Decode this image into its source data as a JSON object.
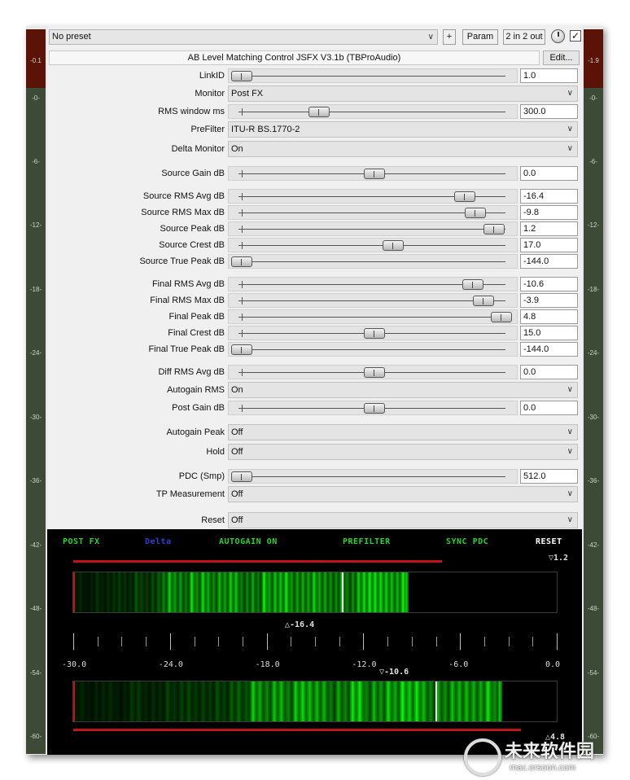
{
  "toolbar": {
    "preset_value": "No preset",
    "plus_label": "+",
    "param_label": "Param",
    "io_label": "2 in 2 out",
    "bypass_check": "☑"
  },
  "title": "AB Level Matching Control JSFX V3.1b (TBProAudio)",
  "edit_label": "Edit...",
  "meters": {
    "left_top": "-0.1",
    "right_top": "-1.9",
    "ticks": [
      "-0-",
      "-6-",
      "-12-",
      "-18-",
      "-24-",
      "-30-",
      "-36-",
      "-42-",
      "-48-",
      "-54-",
      "-60-"
    ]
  },
  "params": [
    {
      "id": "linkid",
      "label": "LinkID",
      "type": "slider",
      "value": "1.0",
      "level": 0.0
    },
    {
      "id": "monitor",
      "label": "Monitor",
      "type": "dropdown",
      "value": "Post FX"
    },
    {
      "id": "rms-window",
      "label": "RMS window ms",
      "type": "slider",
      "value": "300.0",
      "level": 0.29
    },
    {
      "id": "prefilter",
      "label": "PreFilter",
      "type": "dropdown",
      "value": "ITU-R BS.1770-2"
    },
    {
      "id": "delta-monitor",
      "label": "Delta Monitor",
      "type": "dropdown",
      "value": "On"
    },
    {
      "id": "source-gain",
      "label": "Source Gain dB",
      "type": "slider",
      "value": "0.0",
      "level": 0.5
    },
    {
      "id": "source-rms-avg",
      "label": "Source RMS Avg dB",
      "type": "slider",
      "value": "-16.4",
      "level": 0.84
    },
    {
      "id": "source-rms-max",
      "label": "Source RMS Max dB",
      "type": "slider",
      "value": "-9.8",
      "level": 0.88
    },
    {
      "id": "source-peak",
      "label": "Source Peak dB",
      "type": "slider",
      "value": "1.2",
      "level": 0.95
    },
    {
      "id": "source-crest",
      "label": "Source Crest dB",
      "type": "slider",
      "value": "17.0",
      "level": 0.57
    },
    {
      "id": "source-true-peak",
      "label": "Source True Peak dB",
      "type": "slider",
      "value": "-144.0",
      "level": 0.0
    },
    {
      "id": "final-rms-avg",
      "label": "Final RMS Avg dB",
      "type": "slider",
      "value": "-10.6",
      "level": 0.87
    },
    {
      "id": "final-rms-max",
      "label": "Final RMS Max dB",
      "type": "slider",
      "value": "-3.9",
      "level": 0.91
    },
    {
      "id": "final-peak",
      "label": "Final Peak dB",
      "type": "slider",
      "value": "4.8",
      "level": 0.98
    },
    {
      "id": "final-crest",
      "label": "Final Crest dB",
      "type": "slider",
      "value": "15.0",
      "level": 0.5
    },
    {
      "id": "final-true-peak",
      "label": "Final True Peak dB",
      "type": "slider",
      "value": "-144.0",
      "level": 0.0
    },
    {
      "id": "diff-rms-avg",
      "label": "Diff RMS Avg dB",
      "type": "slider",
      "value": "0.0",
      "level": 0.5
    },
    {
      "id": "autogain-rms",
      "label": "Autogain RMS",
      "type": "dropdown",
      "value": "On"
    },
    {
      "id": "post-gain",
      "label": "Post Gain dB",
      "type": "slider",
      "value": "0.0",
      "level": 0.5
    },
    {
      "id": "autogain-peak",
      "label": "Autogain Peak",
      "type": "dropdown",
      "value": "Off"
    },
    {
      "id": "hold",
      "label": "Hold",
      "type": "dropdown",
      "value": "Off"
    },
    {
      "id": "pdc",
      "label": "PDC (Smp)",
      "type": "slider",
      "value": "512.0",
      "level": 0.0
    },
    {
      "id": "tp-measurement",
      "label": "TP Measurement",
      "type": "dropdown",
      "value": "Off"
    },
    {
      "id": "reset",
      "label": "Reset",
      "type": "dropdown",
      "value": "Off"
    }
  ],
  "display": {
    "status": [
      {
        "id": "post-fx",
        "label": "POST FX",
        "color": "#27d52a"
      },
      {
        "id": "delta",
        "label": "Delta",
        "color": "#2f3fd8"
      },
      {
        "id": "autogain-on",
        "label": "AUTOGAIN ON",
        "color": "#27d52a"
      },
      {
        "id": "prefilter",
        "label": "PREFILTER",
        "color": "#27d52a"
      },
      {
        "id": "sync-pdc",
        "label": "SYNC PDC",
        "color": "#27d52a"
      },
      {
        "id": "reset",
        "label": "RESET",
        "color": "#ffffff"
      }
    ],
    "source_peak_marker": "▽1.2",
    "source_rms_marker": "△-16.4",
    "final_rms_marker": "▽-10.6",
    "final_peak_marker": "△4.8",
    "scale_labels": [
      "-30.0",
      "-24.0",
      "-18.0",
      "-12.0",
      "-6.0",
      "0.0"
    ],
    "source_meter": {
      "rms_db": -16.4,
      "peak_db": 1.2
    },
    "final_meter": {
      "rms_db": -10.6,
      "peak_db": 4.8
    }
  },
  "watermark": {
    "brand": "未来软件园",
    "url": "mac.orsoon.com"
  }
}
